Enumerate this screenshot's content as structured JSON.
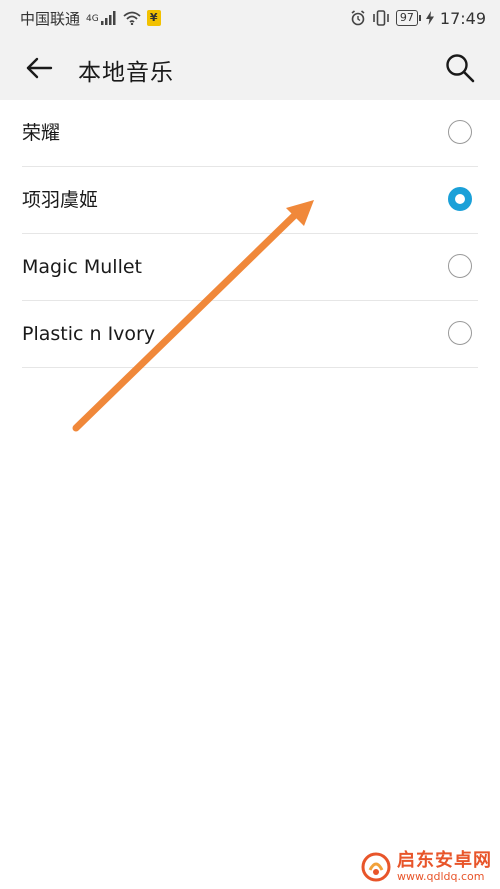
{
  "status_bar": {
    "carrier": "中国联通",
    "network": "4G",
    "badge": "¥",
    "battery": "97",
    "time": "17:49"
  },
  "toolbar": {
    "title": "本地音乐"
  },
  "list": {
    "items": [
      {
        "label": "荣耀",
        "checked": false
      },
      {
        "label": "项羽虞姬",
        "checked": true
      },
      {
        "label": "Magic Mullet",
        "checked": false
      },
      {
        "label": "Plastic n Ivory",
        "checked": false
      }
    ]
  },
  "watermark": {
    "title": "启东安卓网",
    "url": "www.qdldq.com"
  },
  "colors": {
    "accent": "#1aa0d8",
    "arrow": "#f0883a",
    "watermark": "#e8552a"
  }
}
